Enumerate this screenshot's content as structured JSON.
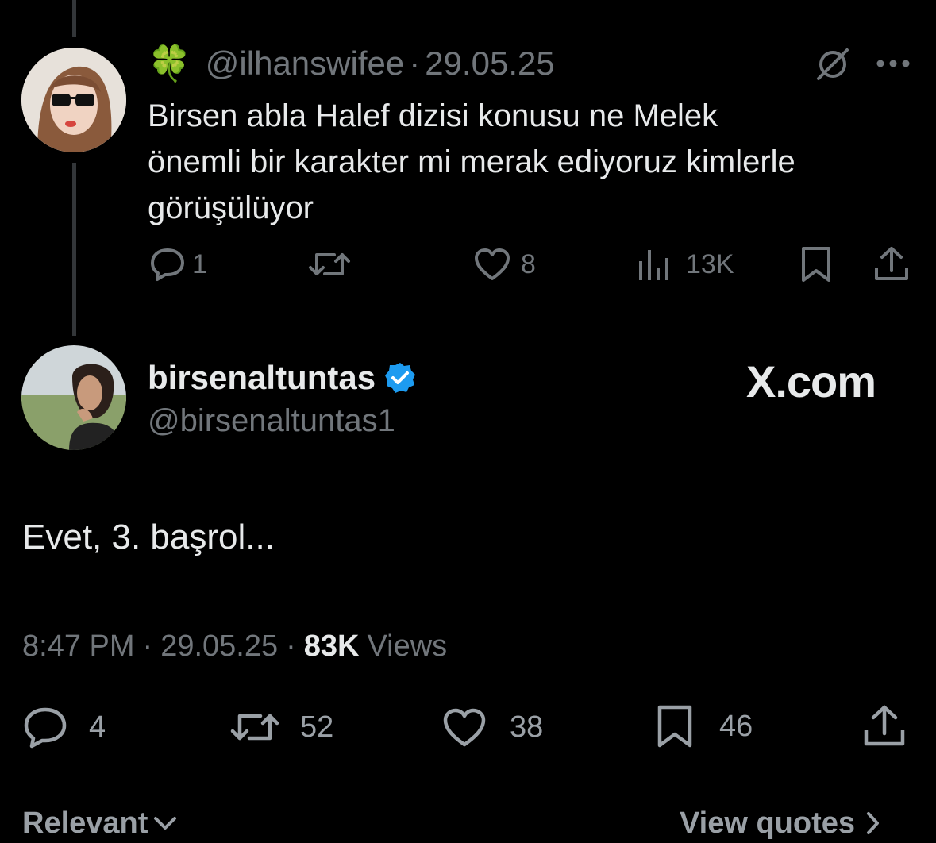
{
  "reply_tweet": {
    "emoji": "🍀",
    "handle": "@ilhanswifee",
    "dot": "·",
    "date": "29.05.25",
    "text_lines": [
      "Birsen abla Halef dizisi konusu ne Melek",
      "önemli bir karakter mi merak ediyoruz kimlerle",
      "görüşülüyor"
    ],
    "actions": {
      "replies": "1",
      "likes": "8",
      "views": "13K"
    }
  },
  "main_tweet": {
    "display_name": "birsenaltuntas",
    "handle": "@birsenaltuntas1",
    "watermark": "X.com",
    "text": "Evet, 3. başrol...",
    "time": "8:47 PM",
    "dot": "·",
    "date": "29.05.25",
    "views_count": "83K",
    "views_label": "Views",
    "actions": {
      "replies": "4",
      "reposts": "52",
      "likes": "38",
      "bookmarks": "46"
    }
  },
  "footer": {
    "sort_label": "Relevant",
    "quotes_label": "View quotes"
  },
  "colors": {
    "background": "#000000",
    "text": "#e7e9ea",
    "muted": "#71767b",
    "verified": "#1d9bf0"
  }
}
